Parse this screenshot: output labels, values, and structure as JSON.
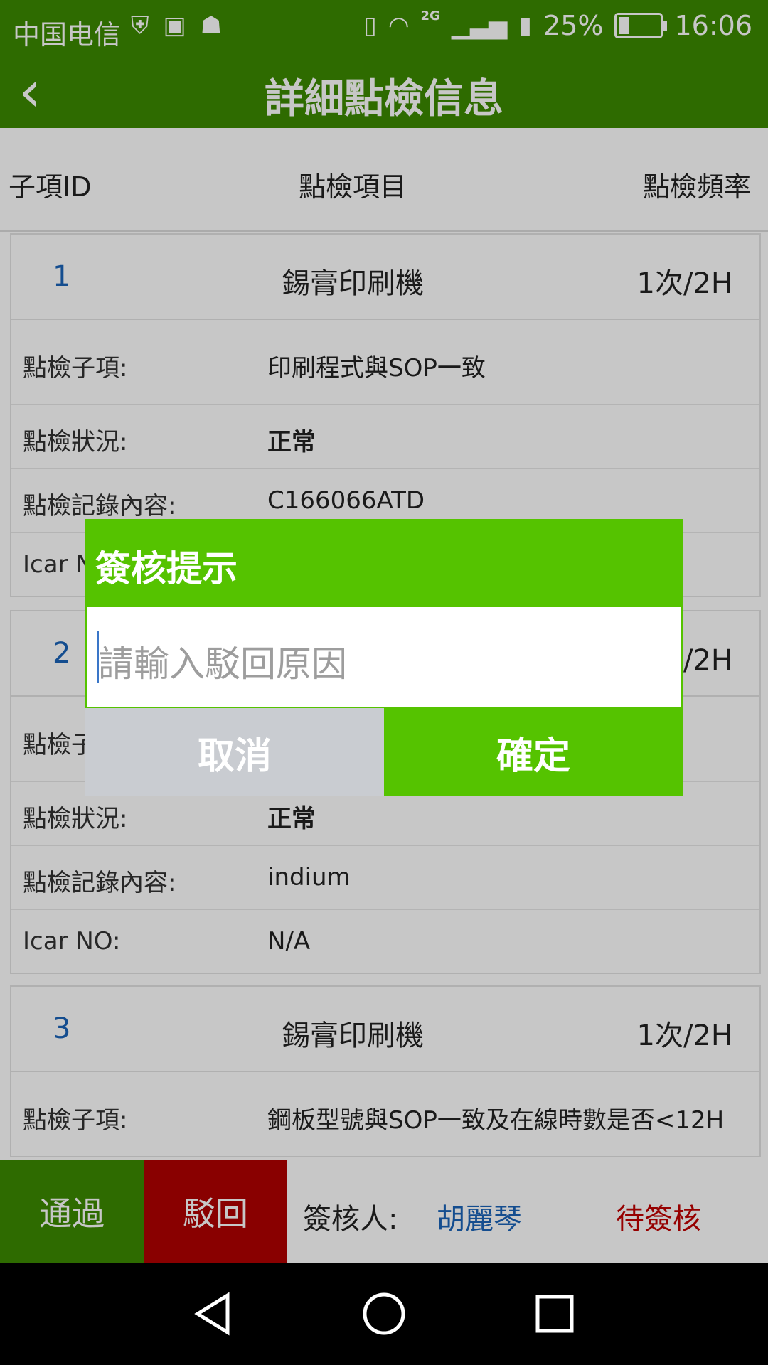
{
  "status_bar": {
    "carrier": "中国电信",
    "network_type": "2G",
    "battery_percent": "25%",
    "time": "16:06"
  },
  "topbar": {
    "back_icon": "chevron-left-icon",
    "title": "詳細點檢信息"
  },
  "table_header": {
    "col_id": "子項ID",
    "col_item": "點檢項目",
    "col_freq": "點檢頻率"
  },
  "cards": [
    {
      "id": "1",
      "name": "錫膏印刷機",
      "freq": "1次/2H",
      "rows": [
        {
          "label": "點檢子項:",
          "value": "印刷程式與SOP一致"
        },
        {
          "label": "點檢狀況:",
          "value": "正常"
        },
        {
          "label": "點檢記錄內容:",
          "value": "C166066ATD"
        },
        {
          "label": "Icar NO:",
          "value": ""
        }
      ]
    },
    {
      "id": "2",
      "name": "",
      "freq": "1次/2H",
      "rows": [
        {
          "label": "點檢子項:",
          "value": ""
        },
        {
          "label": "點檢狀況:",
          "value": "正常"
        },
        {
          "label": "點檢記錄內容:",
          "value": "indium"
        },
        {
          "label": "Icar NO:",
          "value": "N/A"
        }
      ]
    },
    {
      "id": "3",
      "name": "錫膏印刷機",
      "freq": "1次/2H",
      "rows": [
        {
          "label": "點檢子項:",
          "value": "鋼板型號與SOP一致及在線時數是否<12H"
        }
      ]
    }
  ],
  "dialog": {
    "title": "簽核提示",
    "input_placeholder": "請輸入駁回原因",
    "input_value": "",
    "cancel_label": "取消",
    "confirm_label": "確定"
  },
  "bottom_bar": {
    "pass_label": "通過",
    "reject_label": "駁回",
    "signer_label": "簽核人:",
    "signer_name": "胡麗琴",
    "status": "待簽核"
  },
  "nav_bar": {
    "back_icon": "triangle-back-icon",
    "home_icon": "circle-home-icon",
    "recents_icon": "square-recents-icon"
  },
  "colors": {
    "app_green": "#3c8a00",
    "dialog_green": "#55c300",
    "reject_red": "#b00000",
    "link_blue": "#1a63b8",
    "pending_red": "#c00000"
  }
}
